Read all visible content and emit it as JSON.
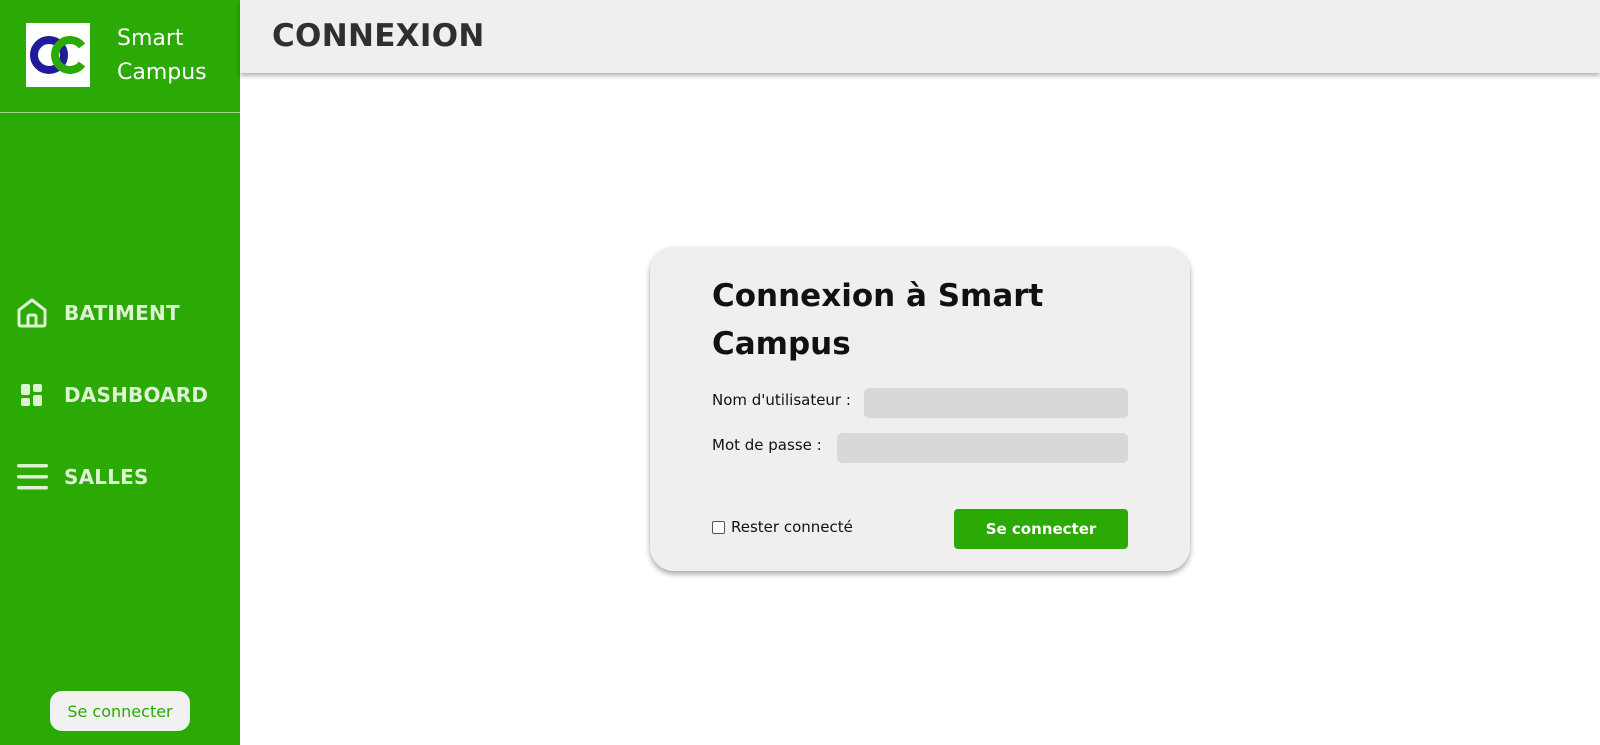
{
  "sidebar": {
    "brand": {
      "line1": "Smart",
      "line2": "Campus",
      "logo_icon": "oc-logo-icon"
    },
    "items": [
      {
        "label": "BATIMENT",
        "icon": "home-icon"
      },
      {
        "label": "DASHBOARD",
        "icon": "dashboard-icon"
      },
      {
        "label": "SALLES",
        "icon": "menu-icon"
      }
    ],
    "login_button": "Se connecter"
  },
  "header": {
    "title": "CONNEXION"
  },
  "login": {
    "title": "Connexion à Smart Campus",
    "username_label": "Nom d'utilisateur :",
    "username_value": "",
    "password_label": "Mot de passe :",
    "password_value": "",
    "remember_label": "Rester connecté",
    "remember_checked": false,
    "submit": "Se connecter"
  },
  "colors": {
    "accent": "#2ba904",
    "logo_blue": "#1f1b9a",
    "header_bg": "#efefef",
    "card_bg": "#efefef",
    "input_bg": "#d8d8d8"
  }
}
